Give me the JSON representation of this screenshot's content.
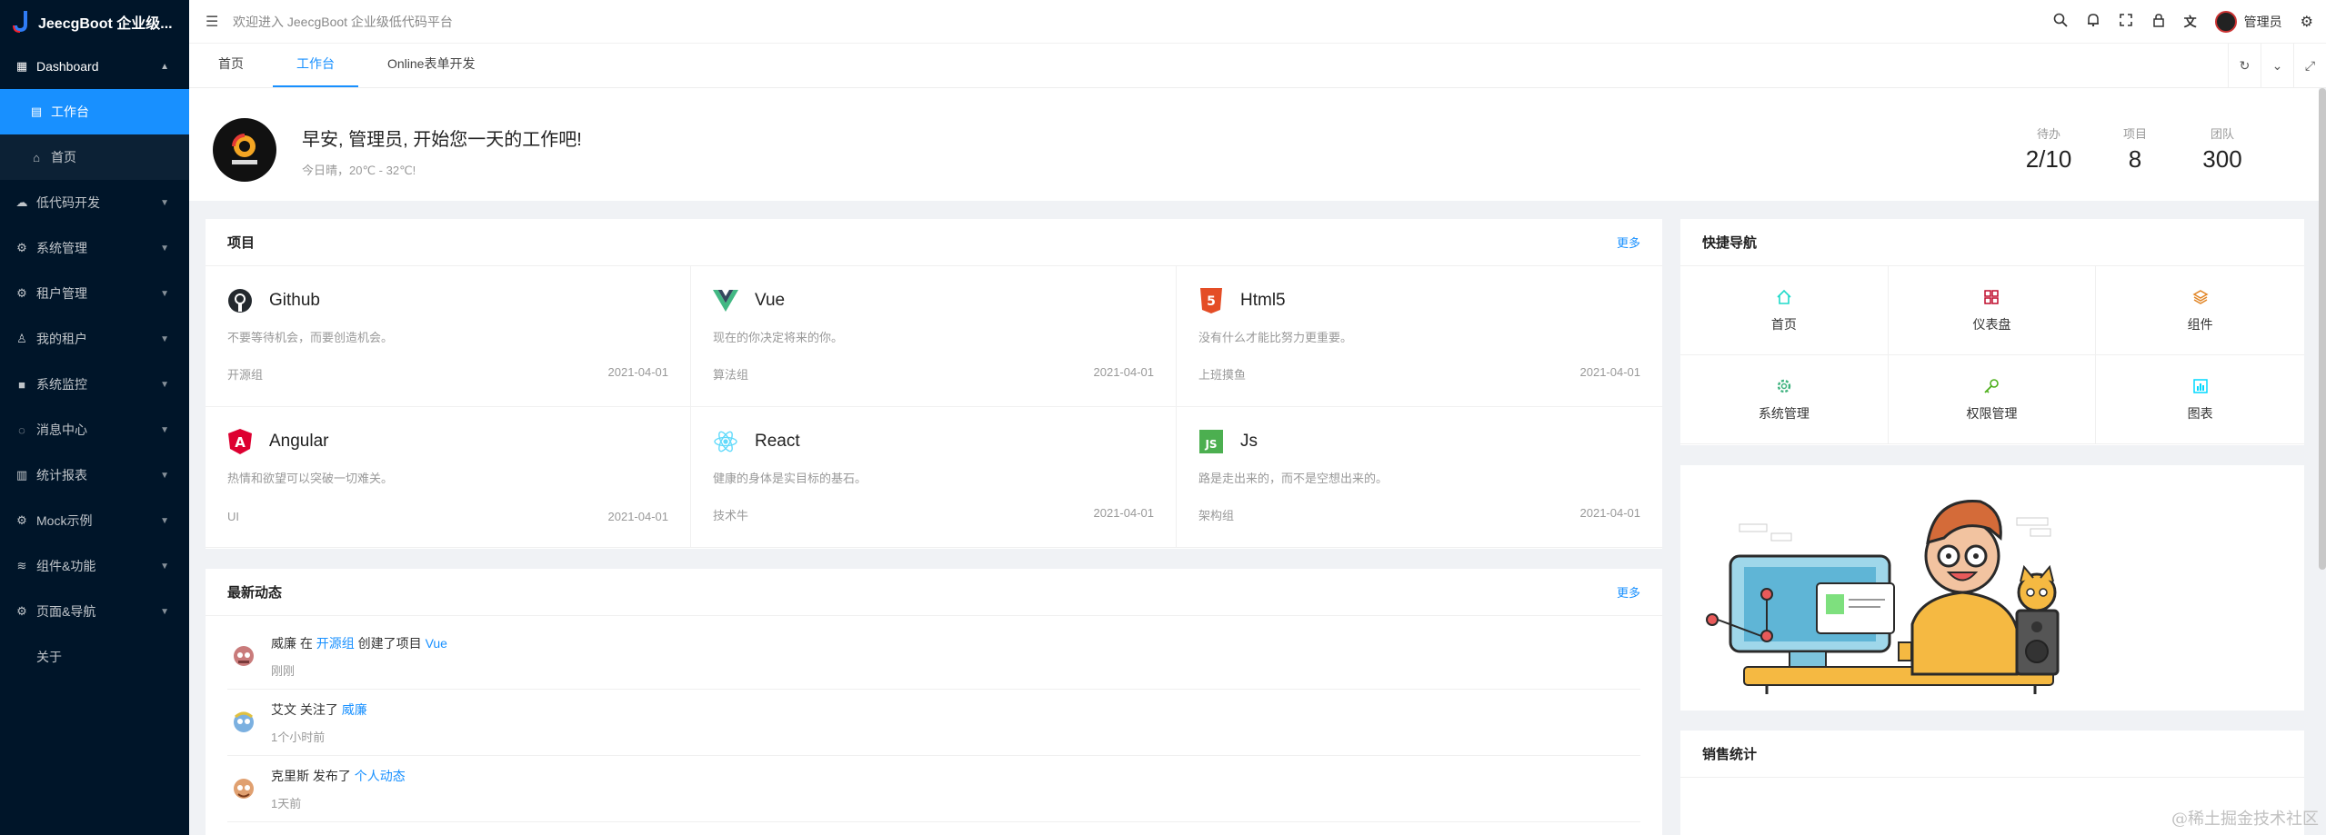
{
  "app": {
    "title": "JeecgBoot 企业级..."
  },
  "sidebar": {
    "items": [
      {
        "label": "Dashboard",
        "icon": "dashboard-icon",
        "open": true,
        "children": [
          {
            "label": "工作台",
            "active": true
          },
          {
            "label": "首页"
          }
        ]
      },
      {
        "label": "低代码开发",
        "icon": "cloud-icon"
      },
      {
        "label": "系统管理",
        "icon": "gear-icon"
      },
      {
        "label": "租户管理",
        "icon": "gear-icon"
      },
      {
        "label": "我的租户",
        "icon": "user-icon"
      },
      {
        "label": "系统监控",
        "icon": "video-icon"
      },
      {
        "label": "消息中心",
        "icon": "message-icon"
      },
      {
        "label": "统计报表",
        "icon": "bar-chart-icon"
      },
      {
        "label": "Mock示例",
        "icon": "gear-icon"
      },
      {
        "label": "组件&功能",
        "icon": "layers-icon"
      },
      {
        "label": "页面&导航",
        "icon": "gear-icon"
      },
      {
        "label": "关于",
        "icon": ""
      }
    ]
  },
  "header": {
    "welcome": "欢迎进入 JeecgBoot 企业级低代码平台",
    "user_name": "管理员"
  },
  "tabs": [
    {
      "label": "首页"
    },
    {
      "label": "工作台",
      "active": true
    },
    {
      "label": "Online表单开发"
    }
  ],
  "welcome": {
    "greeting": "早安, 管理员, 开始您一天的工作吧!",
    "weather": "今日晴，20℃ - 32℃!",
    "stats": [
      {
        "label": "待办",
        "value": "2/10"
      },
      {
        "label": "项目",
        "value": "8"
      },
      {
        "label": "团队",
        "value": "300"
      }
    ]
  },
  "projects": {
    "title": "项目",
    "more": "更多",
    "items": [
      {
        "name": "Github",
        "desc": "不要等待机会，而要创造机会。",
        "group": "开源组",
        "date": "2021-04-01",
        "icon": "github-icon",
        "color": "#24292e"
      },
      {
        "name": "Vue",
        "desc": "现在的你决定将来的你。",
        "group": "算法组",
        "date": "2021-04-01",
        "icon": "vue-icon",
        "color": "#42b883"
      },
      {
        "name": "Html5",
        "desc": "没有什么才能比努力更重要。",
        "group": "上班摸鱼",
        "date": "2021-04-01",
        "icon": "html5-icon",
        "color": "#e44d26"
      },
      {
        "name": "Angular",
        "desc": "热情和欲望可以突破一切难关。",
        "group": "UI",
        "date": "2021-04-01",
        "icon": "angular-icon",
        "color": "#dd0031"
      },
      {
        "name": "React",
        "desc": "健康的身体是实目标的基石。",
        "group": "技术牛",
        "date": "2021-04-01",
        "icon": "react-icon",
        "color": "#61dafb"
      },
      {
        "name": "Js",
        "desc": "路是走出来的，而不是空想出来的。",
        "group": "架构组",
        "date": "2021-04-01",
        "icon": "js-icon",
        "color": "#4caf50"
      }
    ]
  },
  "dynamics": {
    "title": "最新动态",
    "more": "更多",
    "items": [
      {
        "user": "威廉",
        "mid": "在",
        "link1": "开源组",
        "verb": "创建了项目",
        "link2": "Vue",
        "time": "刚刚"
      },
      {
        "user": "艾文",
        "mid": "关注了",
        "link1": "威廉",
        "verb": "",
        "link2": "",
        "time": "1个小时前"
      },
      {
        "user": "克里斯",
        "mid": "发布了",
        "link1": "个人动态",
        "verb": "",
        "link2": "",
        "time": "1天前"
      }
    ]
  },
  "quick_nav": {
    "title": "快捷导航",
    "items": [
      {
        "label": "首页",
        "icon": "home-icon",
        "color": "#1fdaca"
      },
      {
        "label": "仪表盘",
        "icon": "dashboard-icon",
        "color": "#bf0c2c"
      },
      {
        "label": "组件",
        "icon": "layers-icon",
        "color": "#e18525"
      },
      {
        "label": "系统管理",
        "icon": "gear-icon",
        "color": "#3fb27f"
      },
      {
        "label": "权限管理",
        "icon": "key-icon",
        "color": "#4daf1bc9"
      },
      {
        "label": "图表",
        "icon": "bar-chart-icon",
        "color": "#00d8ff"
      }
    ]
  },
  "sales": {
    "title": "销售统计"
  },
  "watermark": "@稀土掘金技术社区"
}
